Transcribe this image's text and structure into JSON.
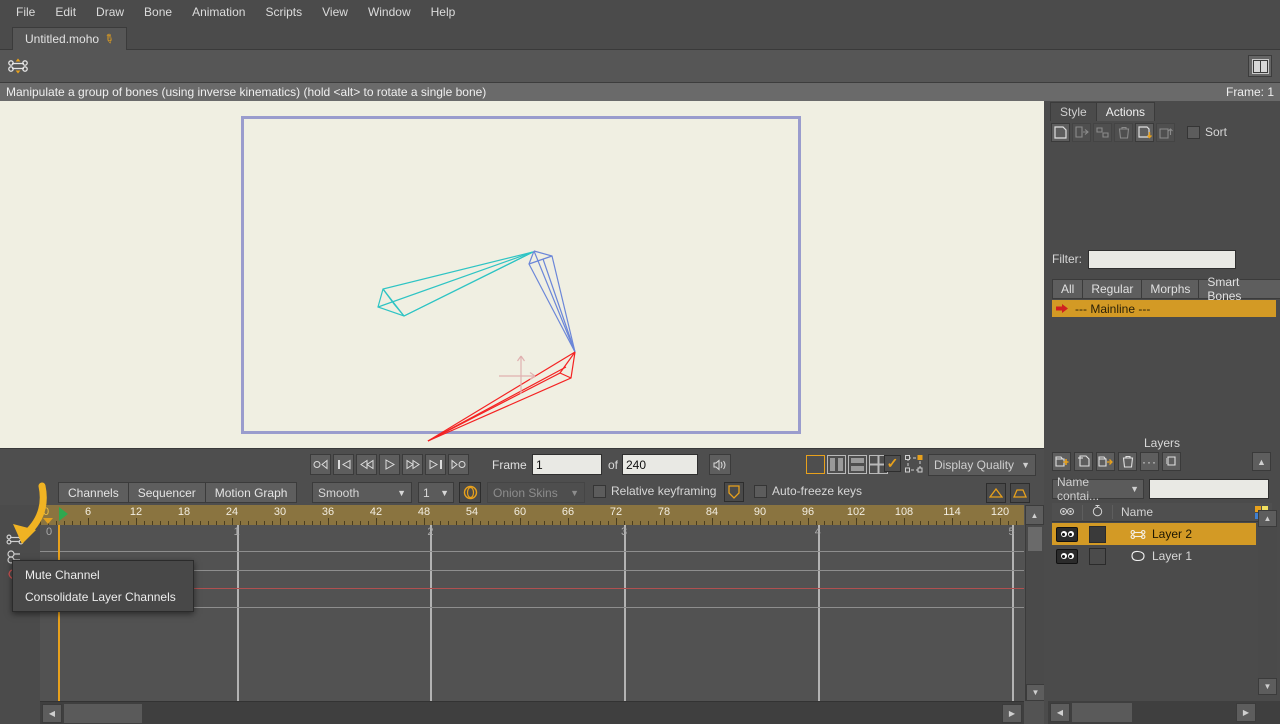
{
  "app": {
    "menu": [
      "File",
      "Edit",
      "Draw",
      "Bone",
      "Animation",
      "Scripts",
      "View",
      "Window",
      "Help"
    ],
    "document_tab": "Untitled.moho",
    "document_modified_icon": "pencil-icon",
    "tool_icon": "bone-manipulate-icon",
    "panel_toggle_icon": "panels-icon"
  },
  "status": {
    "message": "Manipulate a group of bones (using inverse kinematics) (hold <alt> to rotate a single bone)",
    "frame_label": "Frame: 1"
  },
  "viewport": {
    "background": "#f0efe2",
    "canvas_border": "#9a9ccd",
    "bones": [
      {
        "name": "bone-1-cyan",
        "color": "#2ec4c4"
      },
      {
        "name": "bone-2-blue",
        "color": "#6b86d8"
      },
      {
        "name": "bone-3-red",
        "color": "#f42222"
      }
    ],
    "origin_gizmo": "origin-crosshair-icon"
  },
  "playback": {
    "buttons": [
      {
        "name": "jump-to-start-button",
        "glyph": "o◁"
      },
      {
        "name": "previous-keyframe-button",
        "glyph": "|◁"
      },
      {
        "name": "rewind-button",
        "glyph": "◁◁"
      },
      {
        "name": "play-button",
        "glyph": "▷"
      },
      {
        "name": "fast-forward-button",
        "glyph": "▷▷"
      },
      {
        "name": "next-keyframe-button",
        "glyph": "▷|"
      },
      {
        "name": "jump-to-end-button",
        "glyph": "▷o"
      }
    ],
    "frame_label": "Frame",
    "frame_value": "1",
    "of_label": "of",
    "total_frames": "240",
    "sound_icon": "speaker-icon",
    "view_modes": [
      "single-view",
      "two-column-view",
      "two-row-view",
      "quad-view"
    ],
    "view_mode_selected": 0,
    "checkbox_checked": true,
    "select_icon": "select-bbox-icon",
    "display_quality_label": "Display Quality"
  },
  "timeline_toolbar": {
    "tabs": [
      "Channels",
      "Sequencer",
      "Motion Graph"
    ],
    "active_tab": "Channels",
    "interpolation": "Smooth",
    "step_count": "1",
    "onion_button_icon": "onion-ring-icon",
    "onion_skins_label": "Onion Skins",
    "relative_keyframing_label": "Relative keyframing",
    "relative_keyframing_checked": false,
    "shield_icon": "shield-icon",
    "auto_freeze_label": "Auto-freeze keys",
    "auto_freeze_checked": false,
    "right_icons": [
      "triangle-up-icon",
      "trapezoid-icon"
    ]
  },
  "timeline": {
    "ruler_labels": [
      0,
      6,
      12,
      18,
      24,
      30,
      36,
      42,
      48,
      54,
      60,
      66,
      72,
      78,
      84,
      90,
      96,
      102,
      108,
      114,
      120
    ],
    "ruler_step": 6,
    "ruler_max": 123,
    "ruler_bg": "#8a7440",
    "playhead_frame": 0,
    "playhead_marker_icon": "green-playhead-icon",
    "grid_labels": [
      0,
      1,
      2,
      3,
      4,
      5
    ],
    "grid_rows": [
      {
        "name": "channel-row-1"
      },
      {
        "name": "channel-row-2"
      },
      {
        "name": "channel-row-3-red"
      },
      {
        "name": "channel-row-4"
      }
    ],
    "scroll_up_icon": "scroll-up-icon",
    "scroll_down_icon": "scroll-down-icon",
    "scroll_left_icon": "scroll-left-icon",
    "scroll_right_icon": "scroll-right-icon",
    "gutter_icons": [
      "bone-channel-icon",
      "timing-channel-icon",
      "shape-channel-icon"
    ]
  },
  "context_menu": {
    "items": [
      "Mute Channel",
      "Consolidate Layer Channels"
    ]
  },
  "annotation": {
    "arrow_color": "#f0b323",
    "name": "highlight-arrow"
  },
  "right_dock": {
    "tabs": [
      "Style",
      "Actions"
    ],
    "active_tab": "Actions",
    "action_tools": [
      {
        "name": "new-action-button",
        "icon": "new-action-icon",
        "disabled": false
      },
      {
        "name": "duplicate-action-button",
        "icon": "action-right-icon",
        "disabled": true
      },
      {
        "name": "relink-action-button",
        "icon": "action-link-icon",
        "disabled": true
      },
      {
        "name": "delete-action-button",
        "icon": "trash-icon",
        "disabled": true
      },
      {
        "name": "insert-action-button",
        "icon": "action-insert-icon",
        "disabled": false
      },
      {
        "name": "extract-action-button",
        "icon": "action-extract-icon",
        "disabled": true
      }
    ],
    "sort_label": "Sort",
    "sort_checked": false,
    "filter_label": "Filter:",
    "filter_value": "",
    "categories": [
      "All",
      "Regular",
      "Morphs",
      "Smart Bones"
    ],
    "category_active": "All",
    "mainline_label": "--- Mainline ---",
    "mainline_icon": "red-arrow-icon",
    "mainline_color": "#d39a25"
  },
  "layers_panel": {
    "title": "Layers",
    "tools": [
      {
        "name": "new-layer-button",
        "icon": "new-layer-icon"
      },
      {
        "name": "duplicate-layer-button",
        "icon": "duplicate-layer-icon"
      },
      {
        "name": "layer-settings-button",
        "icon": "layer-arrow-icon"
      },
      {
        "name": "delete-layer-button",
        "icon": "trash-icon"
      },
      {
        "name": "more-options-button",
        "icon": "ellipsis-icon"
      },
      {
        "name": "group-layers-button",
        "icon": "group-layers-icon"
      }
    ],
    "collapse_icon": "chevron-up-icon",
    "search_mode": "Name contai...",
    "search_value": "",
    "columns": {
      "visibility": "eye-icon",
      "lock": "timing-icon",
      "name": "Name",
      "color": "color-swatch-icon"
    },
    "rows": [
      {
        "name": "Layer 2",
        "type_icon": "bone-layer-icon",
        "visible": true,
        "selected": true,
        "swatch": "#3a3a3a"
      },
      {
        "name": "Layer 1",
        "type_icon": "vector-layer-icon",
        "visible": true,
        "selected": false,
        "swatch": "transparent"
      }
    ]
  }
}
